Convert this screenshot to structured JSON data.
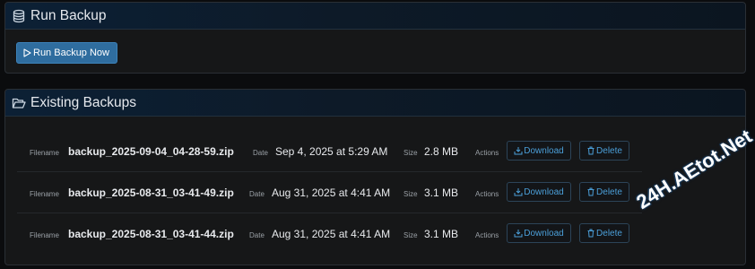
{
  "run_panel": {
    "title": "Run Backup",
    "icon": "database-icon",
    "button_label": "Run Backup Now"
  },
  "backups_panel": {
    "title": "Existing Backups",
    "icon": "folder-open-icon",
    "labels": {
      "filename": "Filename",
      "date": "Date",
      "size": "Size",
      "actions": "Actions"
    },
    "download_label": "Download",
    "delete_label": "Delete",
    "rows": [
      {
        "filename": "backup_2025-09-04_04-28-59.zip",
        "date": "Sep 4, 2025 at 5:29 AM",
        "size": "2.8 MB"
      },
      {
        "filename": "backup_2025-08-31_03-41-49.zip",
        "date": "Aug 31, 2025 at 4:41 AM",
        "size": "3.1 MB"
      },
      {
        "filename": "backup_2025-08-31_03-41-44.zip",
        "date": "Aug 31, 2025 at 4:41 AM",
        "size": "3.1 MB"
      }
    ]
  },
  "watermark": "24H.AEtot.Net",
  "colors": {
    "accent": "#2f6d9f",
    "link": "#4b9fd9",
    "panel_bg": "#161718",
    "header_bg": "#0c2035"
  }
}
